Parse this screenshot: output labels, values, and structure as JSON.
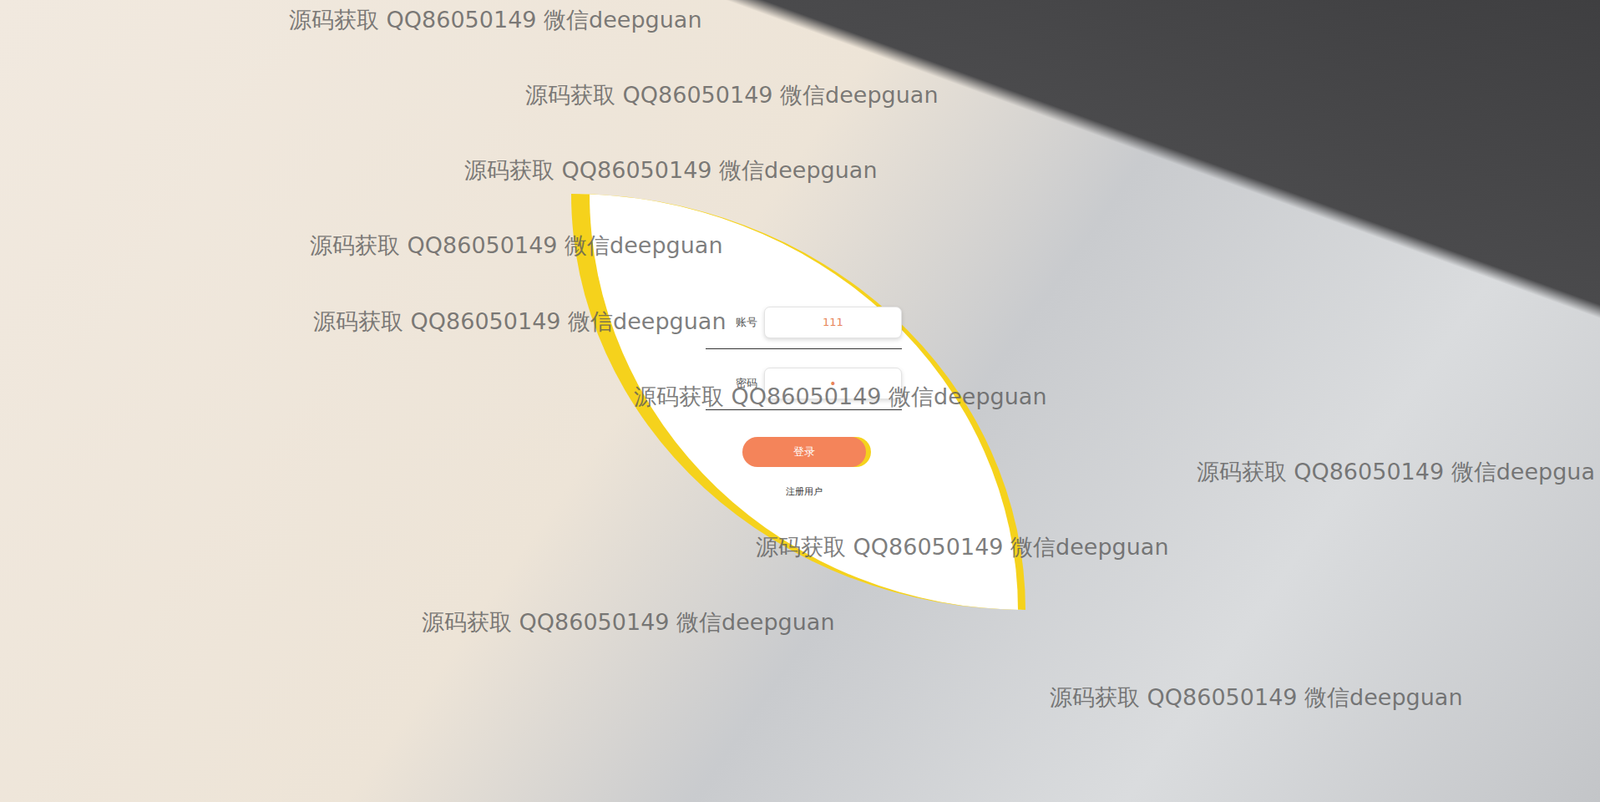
{
  "login": {
    "fields": [
      {
        "label": "账号",
        "value": "111",
        "kind": "text"
      },
      {
        "label": "密码",
        "value": "•",
        "kind": "password"
      }
    ],
    "button": "登录",
    "link": "注册用户"
  },
  "watermarks": [
    "源码获取 QQ86050149 微信deepguan",
    "源码获取 QQ86050149 微信deepguan",
    "源码获取 QQ86050149 微信deepguan",
    "源码获取 QQ86050149 微信deepguan",
    "源码获取 QQ86050149 微信deepguan",
    "源码获取 QQ86050149 微信deepguan",
    "源码获取 QQ86050149 微信deepgua",
    "源码获取 QQ86050149 微信deepguan",
    "源码获取 QQ86050149 微信deepguan",
    "源码获取 QQ86050149 微信deepguan"
  ]
}
